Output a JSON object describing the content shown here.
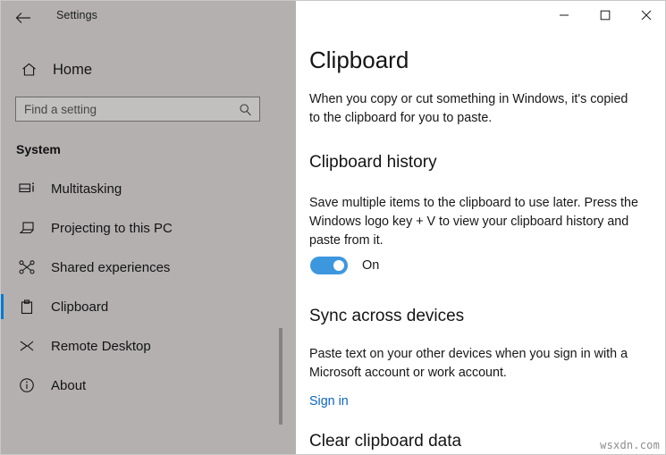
{
  "window": {
    "app_title": "Settings",
    "back_icon": "back-arrow-icon",
    "controls": {
      "minimize": "minimize-icon",
      "maximize": "maximize-icon",
      "close": "close-icon"
    }
  },
  "sidebar": {
    "home_label": "Home",
    "home_icon": "home-icon",
    "search": {
      "placeholder": "Find a setting",
      "value": "",
      "icon": "search-icon"
    },
    "group_title": "System",
    "items": [
      {
        "label": "Multitasking",
        "icon": "multitasking-icon",
        "selected": false
      },
      {
        "label": "Projecting to this PC",
        "icon": "projecting-icon",
        "selected": false
      },
      {
        "label": "Shared experiences",
        "icon": "shared-experiences-icon",
        "selected": false
      },
      {
        "label": "Clipboard",
        "icon": "clipboard-icon",
        "selected": true
      },
      {
        "label": "Remote Desktop",
        "icon": "remote-desktop-icon",
        "selected": false
      },
      {
        "label": "About",
        "icon": "info-icon",
        "selected": false
      }
    ]
  },
  "main": {
    "page_title": "Clipboard",
    "page_description": "When you copy or cut something in Windows, it's copied to the clipboard for you to paste.",
    "clipboard_history": {
      "title": "Clipboard history",
      "description": "Save multiple items to the clipboard to use later. Press the Windows logo key + V to view your clipboard history and paste from it.",
      "toggle_state": "On",
      "toggle_on": true
    },
    "sync_across_devices": {
      "title": "Sync across devices",
      "description": "Paste text on your other devices when you sign in with a Microsoft account or work account.",
      "link_label": "Sign in"
    },
    "clear_clipboard_data": {
      "title": "Clear clipboard data"
    }
  },
  "annotation": {
    "arrow_icon": "left-arrow-annotation-icon",
    "color": "#d62020"
  },
  "watermark": {
    "text": "wsxdn.com"
  },
  "colors": {
    "sidebar_bg": "#b4b0b0",
    "content_bg": "#ffffff",
    "accent": "#0078d7",
    "toggle_on": "#3d97de",
    "link": "#0b65c2"
  }
}
